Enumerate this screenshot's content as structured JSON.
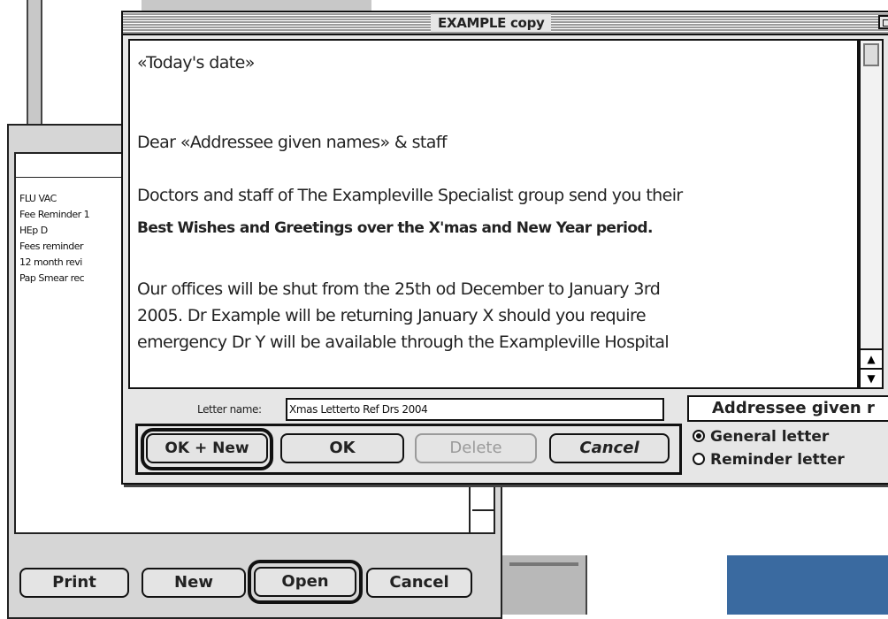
{
  "letter_window": {
    "title": "EXAMPLE copy",
    "body_lines": [
      {
        "text": "«Today's date»",
        "bold": false
      },
      {
        "text": "Dear «Addressee given names» & staff",
        "bold": false
      },
      {
        "text": "Doctors and staff of The Exampleville Specialist group send you their",
        "bold": false
      },
      {
        "text": "Best Wishes and Greetings over the X'mas and New Year period.",
        "bold": true
      },
      {
        "text": "Our offices will be shut from the 25th od December to January 3rd",
        "bold": false
      },
      {
        "text": "2005.  Dr Example  will be returning January X should you require",
        "bold": false
      },
      {
        "text": "emergency Dr Y will be available through the Exampleville Hospital",
        "bold": false
      }
    ],
    "letter_name_label": "Letter name:",
    "letter_name_value": "Xmas Letterto Ref Drs 2004",
    "addressee_field": "Addressee given r",
    "buttons": {
      "ok_new": "OK + New",
      "ok": "OK",
      "delete": "Delete",
      "cancel": "Cancel"
    },
    "letter_type": {
      "options": [
        "General letter",
        "Reminder letter"
      ],
      "selected": "General letter"
    }
  },
  "back_window": {
    "list_items": [
      "FLU VAC",
      "Fee Reminder 1",
      "HEp D",
      "Fees reminder",
      "12 month revi",
      "Pap Smear rec"
    ],
    "buttons": {
      "print": "Print",
      "new": "New",
      "open": "Open",
      "cancel": "Cancel"
    }
  }
}
